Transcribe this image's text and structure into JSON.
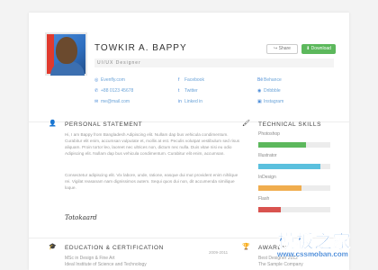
{
  "profile": {
    "name": "TOWKIR A. BAPPY",
    "role": "UI/UX Designer",
    "share_label": "Share",
    "download_label": "Download"
  },
  "contacts": {
    "col1": [
      {
        "icon": "globe-icon",
        "text": "Evenfly.com"
      },
      {
        "icon": "phone-icon",
        "text": "+88 0123 45678"
      },
      {
        "icon": "mail-icon",
        "text": "me@mail.com"
      }
    ],
    "col2": [
      {
        "icon": "facebook-icon",
        "text": "Facebook"
      },
      {
        "icon": "twitter-icon",
        "text": "Twitter"
      },
      {
        "icon": "linkedin-icon",
        "text": "Linked in"
      }
    ],
    "col3": [
      {
        "icon": "behance-icon",
        "text": "Behance"
      },
      {
        "icon": "dribbble-icon",
        "text": "Dribbble"
      },
      {
        "icon": "instagram-icon",
        "text": "Instagram"
      }
    ]
  },
  "personal_statement": {
    "title": "PERSONAL STATEMENT",
    "para1": "Hi, I am Bappy from Bangladesh Adipiscing elit. Nullam dap bus vehicula condimentum. Curabitur elit enim, accumsan vulputate et, mollis at est. Peculis volutpat vestibulum sed risus aliquam. Proin tortor leo, laoreet nec ultrices non, dictum nec nulla. Duis vitae nisi eu odio Adipiscing elit. Nullam dap bus vehicula condimentum. Curabitur elit enim, accumsan.",
    "para2": "Consectetur adipiscing elit. Vix labore, unde, ratione, easque dui mut provident enim nihilque rei. Vigilat reasanam nam dignissimos autem. Sequi quos dui non, dit accumenda similique loque.",
    "signature": "Totokaard"
  },
  "skills": {
    "title": "TECHNICAL SKILLS",
    "items": [
      {
        "label": "Photoshop",
        "level": 0.66,
        "color": "#5cb85c"
      },
      {
        "label": "Illustrator",
        "level": 0.86,
        "color": "#5bc0de"
      },
      {
        "label": "InDesign",
        "level": 0.6,
        "color": "#f0ad4e"
      },
      {
        "label": "Flash",
        "level": 0.31,
        "color": "#d9534f"
      }
    ]
  },
  "education": {
    "title": "EDUCATION & CERTIFICATION",
    "degree": "MSc in Design & Fine Art",
    "school": "Ideal Institute of Science and Technology",
    "date": "2009-2011"
  },
  "awards": {
    "title": "AWARDS",
    "line1": "Best Designer 2012",
    "line2": "The Sample Company"
  },
  "watermark": {
    "brand": "模板之家",
    "url": "www.cssmoban.com"
  }
}
